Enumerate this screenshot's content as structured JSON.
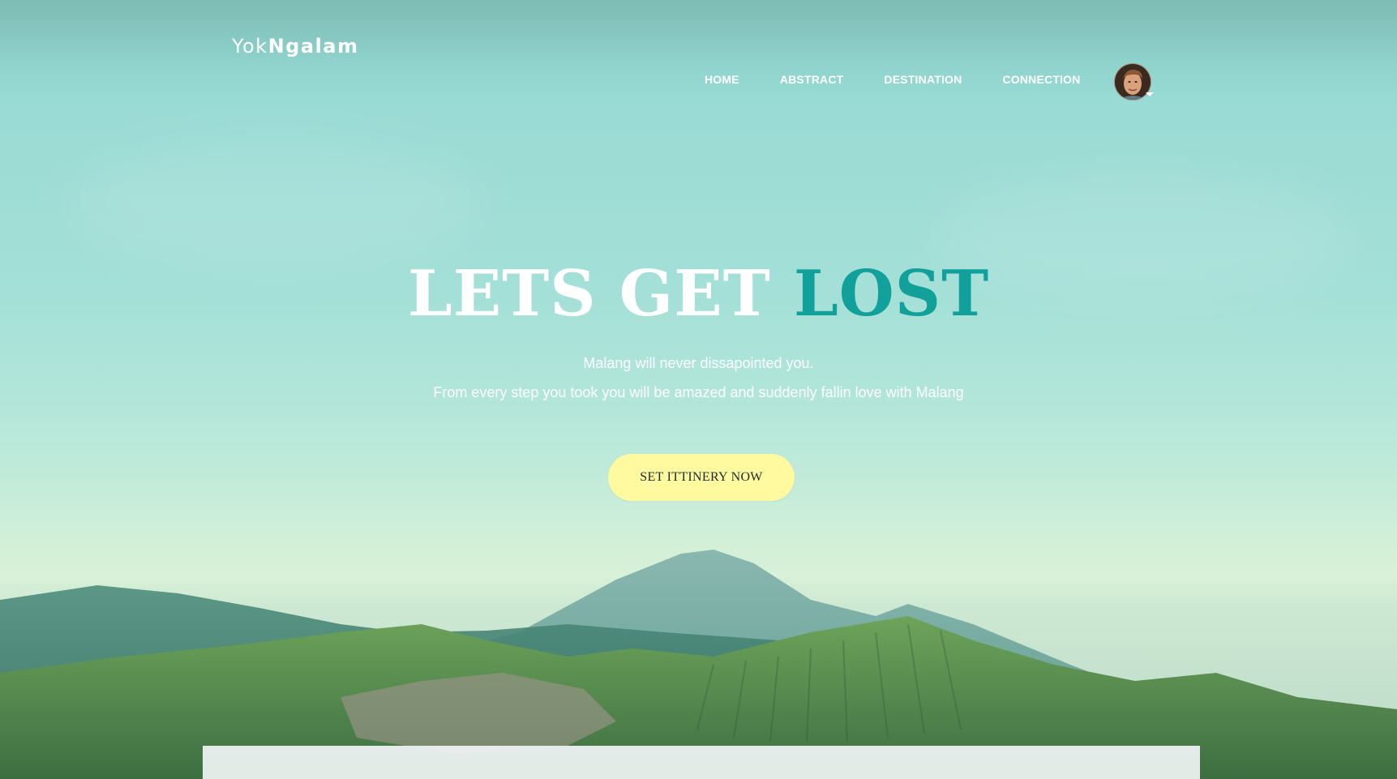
{
  "brand": {
    "logo_light": "Yok",
    "logo_bold": "Ngalam"
  },
  "nav": {
    "items": [
      {
        "label": "HOME"
      },
      {
        "label": "ABSTRACT"
      },
      {
        "label": "DESTINATION"
      },
      {
        "label": "CONNECTION"
      }
    ]
  },
  "user": {
    "avatar_icon": "user-avatar",
    "menu_icon": "caret-down-icon"
  },
  "hero": {
    "headline_part1": "LETS GET",
    "headline_part2": "LOST",
    "subtitle_line1": "Malang will never dissapointed you.",
    "subtitle_line2": "From every step you took you will be amazed and suddenly fallin love with Malang",
    "cta_label": "SET ITTINERY NOW"
  },
  "colors": {
    "accent": "#12a09a",
    "cta_background": "#fff9a0",
    "text_on_hero": "#ffffff"
  }
}
